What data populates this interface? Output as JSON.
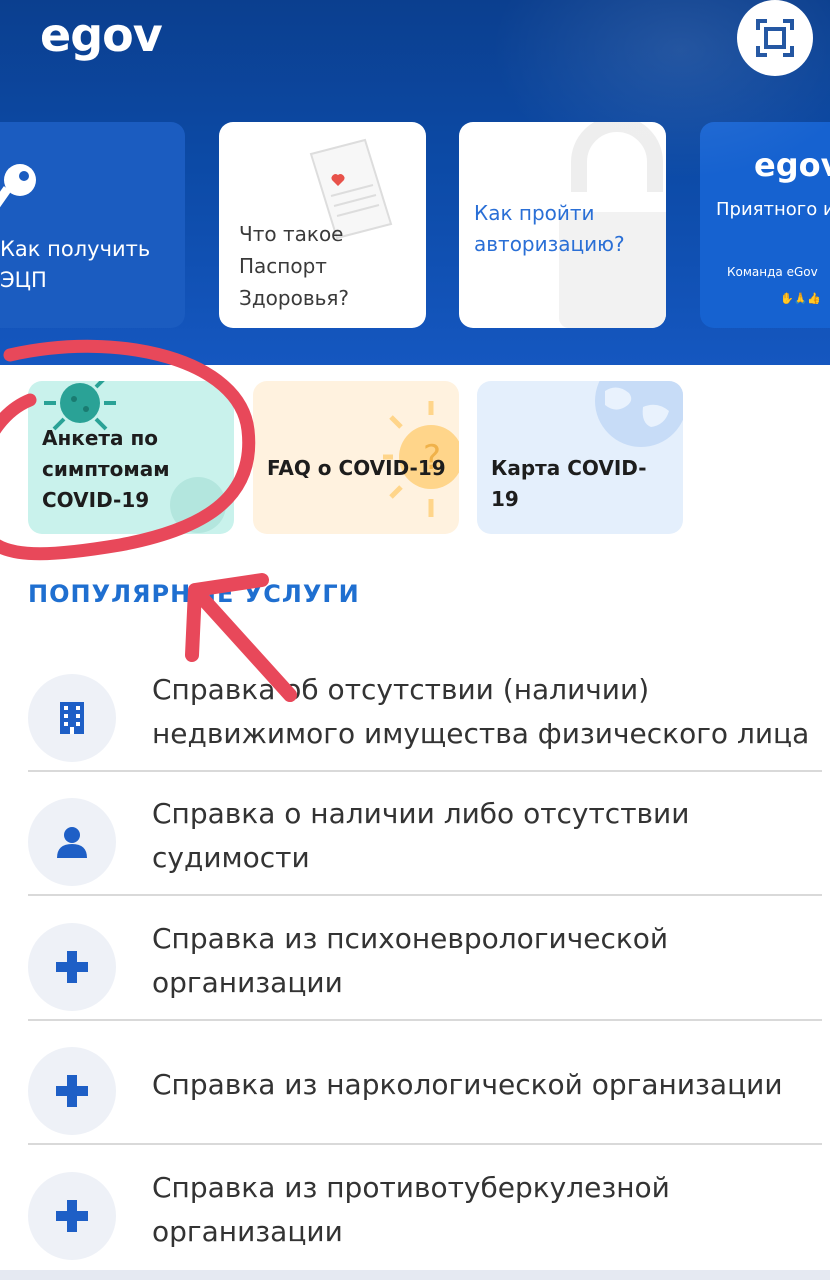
{
  "header": {
    "logo": "egov"
  },
  "stories": [
    {
      "label": "Как получить ЭЦП"
    },
    {
      "label": "Что такое Паспорт Здоровья?"
    },
    {
      "label": "Как пройти авторизацию?"
    },
    {
      "logo": "egov",
      "label": "Приятного использования!",
      "team": "Команда eGov"
    }
  ],
  "covid_cards": [
    {
      "label": "Анкета по симптомам COVID-19"
    },
    {
      "label": "FAQ о COVID-19"
    },
    {
      "label": "Карта COVID-19"
    }
  ],
  "popular": {
    "title": "ПОПУЛЯРНЫЕ УСЛУГИ",
    "services": [
      {
        "icon": "building-icon",
        "label": "Справка об отсутствии (наличии) недвижимого имущества физического лица"
      },
      {
        "icon": "person-icon",
        "label": "Справка о наличии либо отсутствии судимости"
      },
      {
        "icon": "plus-icon",
        "label": "Справка из психоневрологической организации"
      },
      {
        "icon": "plus-icon",
        "label": "Справка из наркологической организации"
      },
      {
        "icon": "plus-icon",
        "label": "Справка из противотуберкулезной организации"
      }
    ]
  },
  "colors": {
    "header_blue": "#0c4aa6",
    "accent_blue": "#1f6fd0",
    "annotation_red": "#e8485a"
  }
}
